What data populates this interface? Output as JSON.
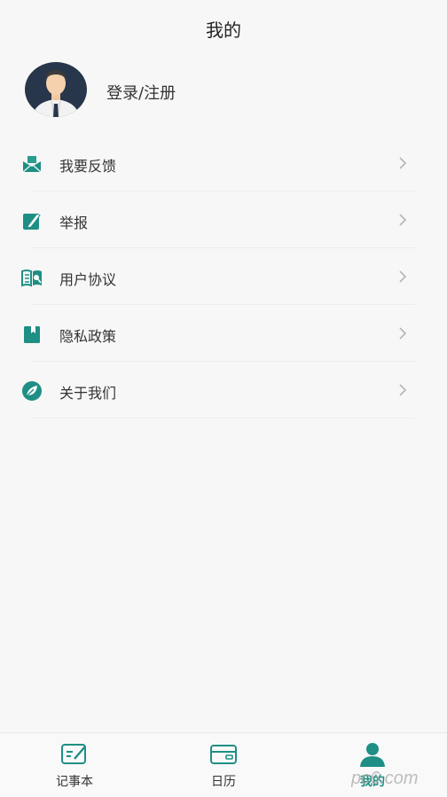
{
  "header": {
    "title": "我的"
  },
  "profile": {
    "login_label": "登录/注册",
    "avatar_icon": "user-avatar-icon"
  },
  "menu": {
    "items": [
      {
        "label": "我要反馈",
        "icon": "feedback-mail-icon"
      },
      {
        "label": "举报",
        "icon": "edit-report-icon"
      },
      {
        "label": "用户协议",
        "icon": "book-search-icon"
      },
      {
        "label": "隐私政策",
        "icon": "bookmark-book-icon"
      },
      {
        "label": "关于我们",
        "icon": "leaf-info-icon"
      }
    ]
  },
  "tabbar": {
    "tabs": [
      {
        "label": "记事本",
        "icon": "notepad-icon",
        "active": false
      },
      {
        "label": "日历",
        "icon": "calendar-card-icon",
        "active": false
      },
      {
        "label": "我的",
        "icon": "person-icon",
        "active": true
      }
    ]
  },
  "watermark": {
    "text": "pc6.com"
  },
  "colors": {
    "accent": "#1f8f85",
    "background": "#f7f7f7"
  }
}
